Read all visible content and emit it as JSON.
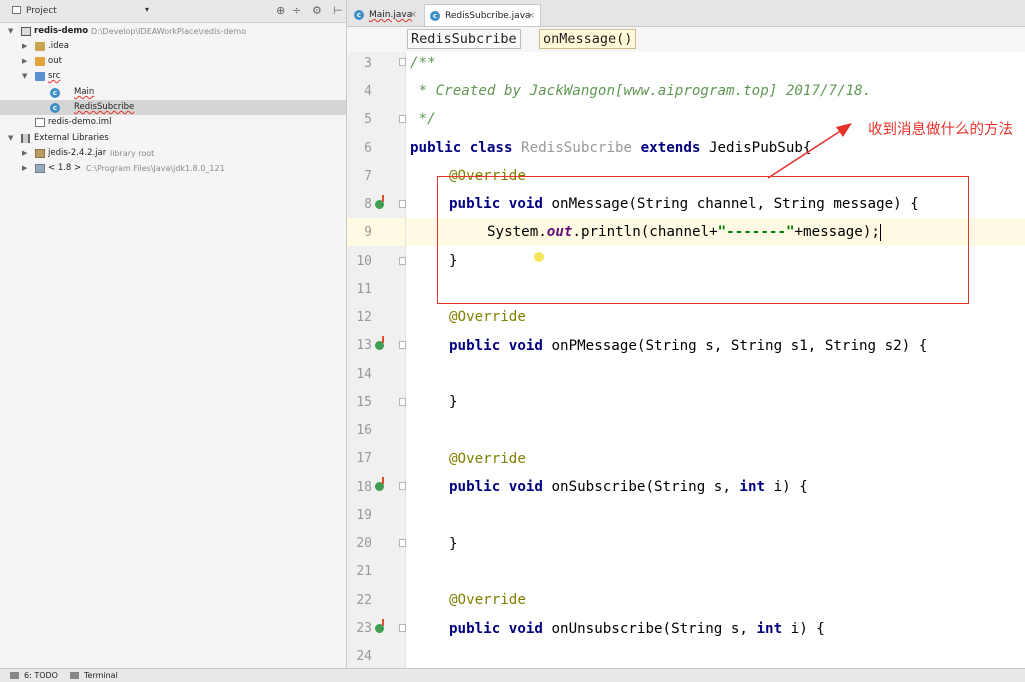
{
  "project_panel": {
    "title": "Project",
    "tree": [
      {
        "label": "redis-demo",
        "hint": "D:\\Develop\\IDEAWorkPlace\\redis-demo"
      },
      {
        "label": ".idea"
      },
      {
        "label": "out"
      },
      {
        "label": "src"
      },
      {
        "label": "Main"
      },
      {
        "label": "RedisSubcribe"
      },
      {
        "label": "redis-demo.iml"
      },
      {
        "label": "External Libraries"
      },
      {
        "label": "jedis-2.4.2.jar",
        "hint": "library root"
      },
      {
        "label": "< 1.8 >",
        "hint": "C:\\Program Files\\Java\\jdk1.8.0_121"
      }
    ]
  },
  "tabs": [
    {
      "label": "Main.java"
    },
    {
      "label": "RedisSubcribe.java"
    }
  ],
  "breadcrumbs": [
    "RedisSubcribe",
    "onMessage()"
  ],
  "line_numbers": [
    "3",
    "4",
    "5",
    "6",
    "7",
    "8",
    "9",
    "10",
    "11",
    "12",
    "13",
    "14",
    "15",
    "16",
    "17",
    "18",
    "19",
    "20",
    "21",
    "22",
    "23",
    "24"
  ],
  "code": {
    "l3": "/**",
    "l4": " * Created by JackWangon[www.aiprogram.top] 2017/7/18.",
    "l5": " */",
    "l6_kw1": "public class ",
    "l6_name": "RedisSubcribe",
    "l6_kw2": " extends ",
    "l6_rest": "JedisPubSub{",
    "override": "@Override",
    "kw_public_void": "public void ",
    "l8_rest": "onMessage(String channel, String message) {",
    "l9_a": "System.",
    "l9_out": "out",
    "l9_b": ".println(channel+",
    "l9_str": "\"-------\"",
    "l9_c": "+message);",
    "close_brace": "}",
    "l13_rest": "onPMessage(String s, String s1, String s2) {",
    "l18_a": "onSubscribe(String s, ",
    "kw_int": "int",
    "l18_b": " i) {",
    "l23_a": "onUnsubscribe(String s, ",
    "l23_b": " i) {"
  },
  "annotation": {
    "text": "收到消息做什么的方法",
    "color": "#e5332a"
  },
  "statusbar": {
    "todo": "6: TODO",
    "terminal": "Terminal"
  }
}
